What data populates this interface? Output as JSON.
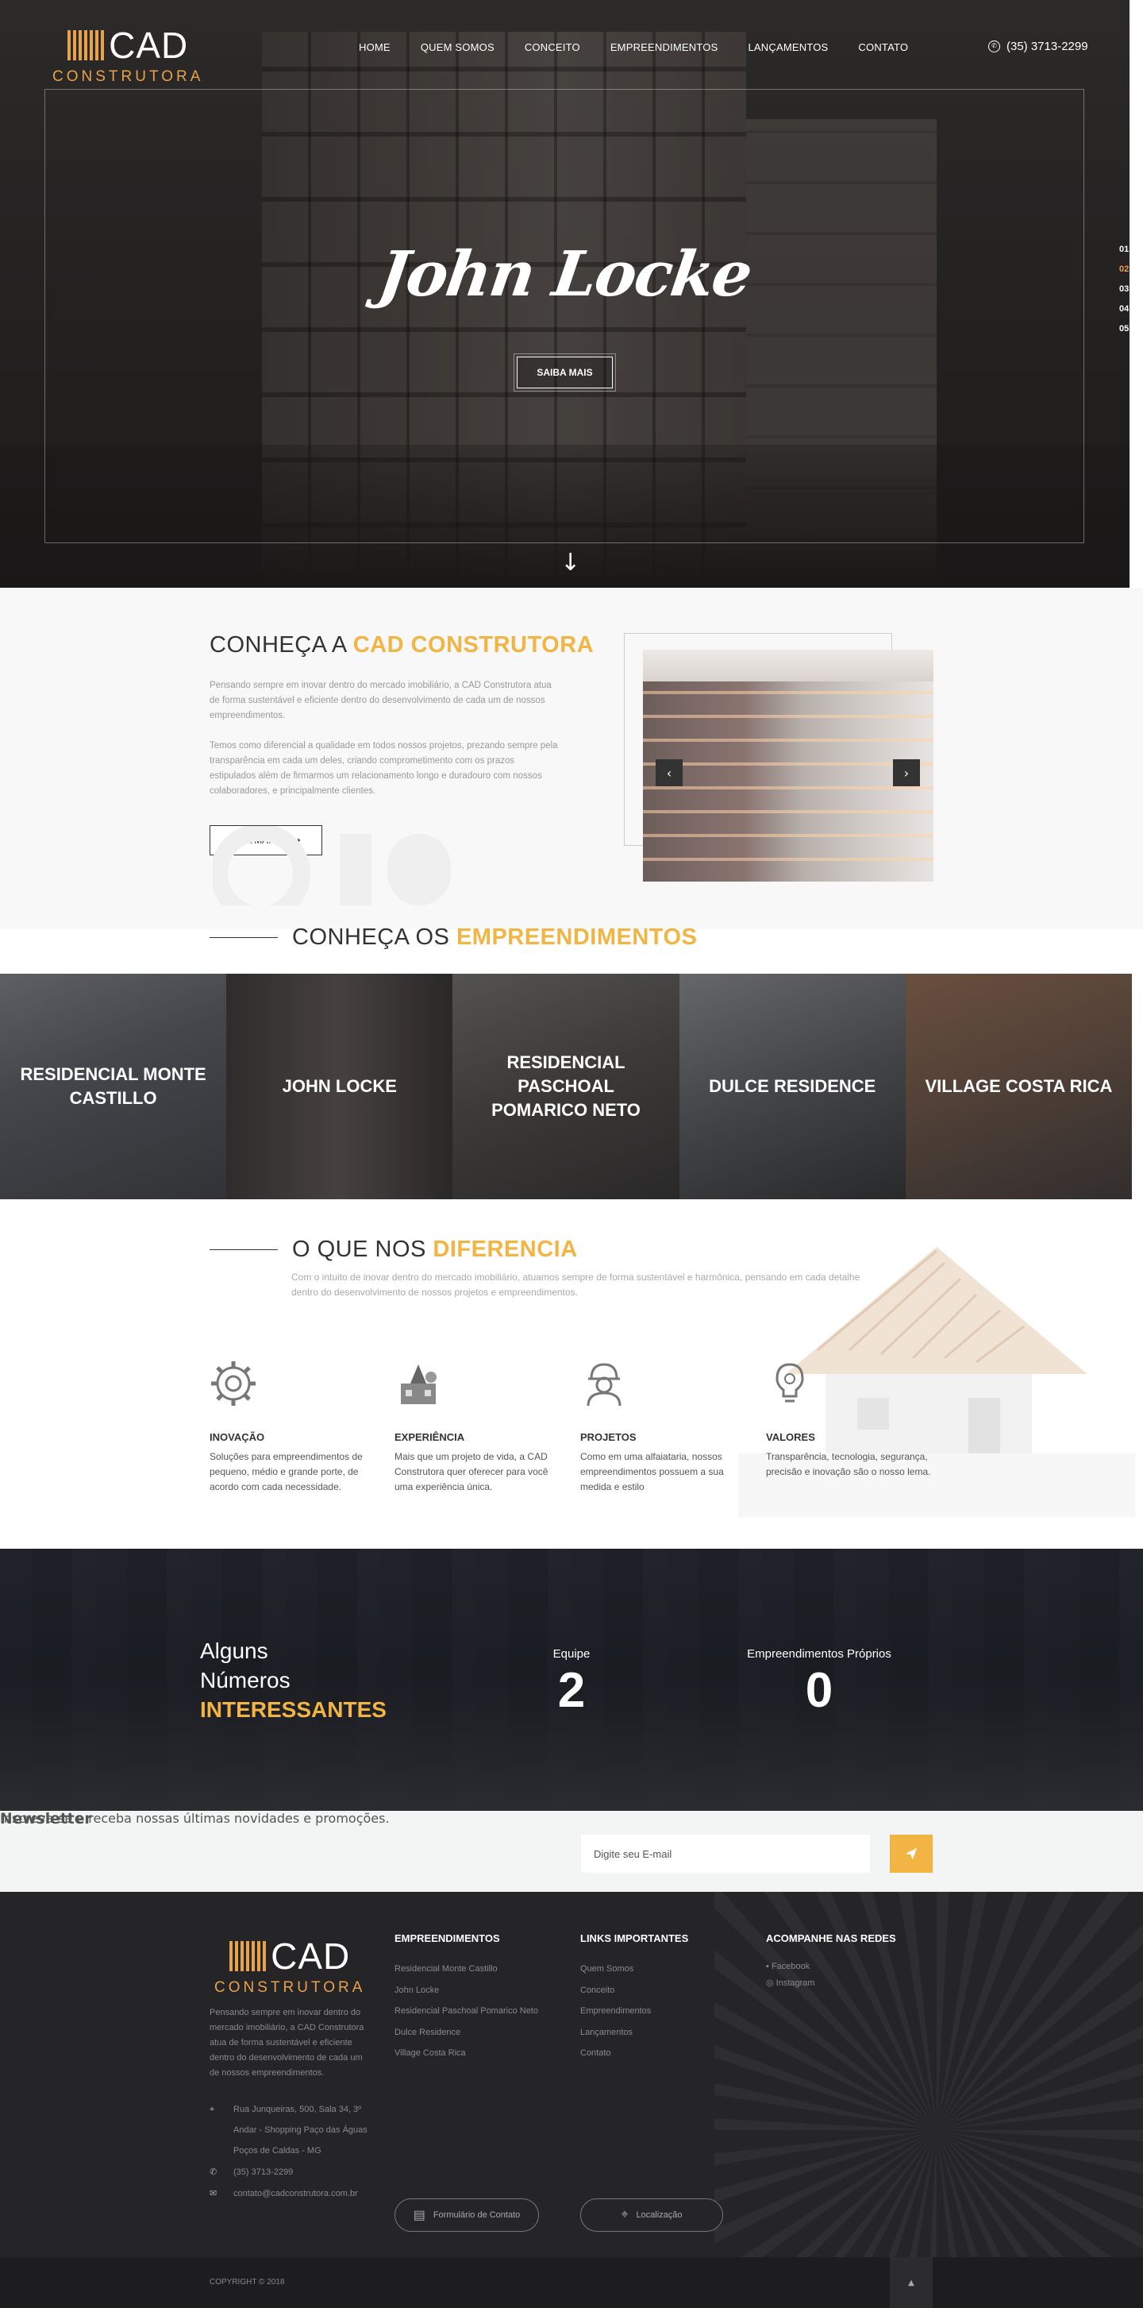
{
  "brand": {
    "name": "CAD",
    "sub": "CONSTRUTORA"
  },
  "nav": {
    "items": [
      "HOME",
      "QUEM SOMOS",
      "CONCEITO",
      "EMPREENDIMENTOS",
      "LANÇAMENTOS",
      "CONTATO"
    ]
  },
  "phone": "(35) 3713-2299",
  "hero": {
    "title": "John Locke",
    "button": "SAIBA MAIS",
    "slides": [
      "01",
      "02",
      "03",
      "04",
      "05"
    ],
    "active_slide": "02"
  },
  "about": {
    "title_pre": "CONHEÇA A",
    "title_accent": "CAD CONSTRUTORA",
    "p1": "Pensando sempre em inovar dentro do mercado imobiliário, a CAD Construtora atua de forma sustentável e eficiente dentro do desenvolvimento de cada um de nossos empreendimentos.",
    "p2": "Temos como diferencial a qualidade em todos nossos projetos, prezando sempre pela transparência em cada um deles, criando comprometimento com os prazos estipulados além de firmarmos um relacionamento longo e duradouro com nossos colaboradores, e principalmente clientes.",
    "button": "LEIA MAIS"
  },
  "empreendimentos": {
    "title_pre": "CONHEÇA OS",
    "title_accent": "EMPREENDIMENTOS",
    "items": [
      "RESIDENCIAL MONTE CASTILLO",
      "JOHN LOCKE",
      "RESIDENCIAL PASCHOAL POMARICO NETO",
      "DULCE RESIDENCE",
      "VILLAGE COSTA RICA"
    ]
  },
  "diferencia": {
    "title_pre": "O QUE NOS",
    "title_accent": "DIFERENCIA",
    "subtitle": "Com o intuito de inovar dentro do mercado imobiliário, atuamos sempre de forma sustentável e harmônica, pensando em cada detalhe dentro do desenvolvimento de nossos projetos e empreendimentos.",
    "features": [
      {
        "title": "INOVAÇÃO",
        "text": "Soluções para empreendimentos de pequeno, médio e grande porte, de acordo com cada necessidade.",
        "icon": "gear-icon"
      },
      {
        "title": "EXPERIÊNCIA",
        "text": "Mais que um projeto de vida, a CAD Construtora quer oferecer para você uma experiência única.",
        "icon": "construction-icon"
      },
      {
        "title": "PROJETOS",
        "text": "Como em uma alfaiataria, nossos empreendimentos possuem a sua medida e estilo",
        "icon": "worker-icon"
      },
      {
        "title": "VALORES",
        "text": "Transparência, tecnologia, segurança, precisão e inovação são o nosso lema.",
        "icon": "idea-icon"
      }
    ]
  },
  "numbers": {
    "title_line1": "Alguns",
    "title_line2": "Números",
    "title_accent": "INTERESSANTES",
    "stats": [
      {
        "label": "Equipe",
        "value": "2"
      },
      {
        "label": "Empreendimentos Próprios",
        "value": "0"
      }
    ]
  },
  "newsletter": {
    "title": "Newsletter",
    "text": "Inscreva-se e receba nossas últimas novidades e promoções.",
    "placeholder": "Digite seu E-mail"
  },
  "footer": {
    "about": "Pensando sempre em inovar dentro do mercado imobiliário, a CAD Construtora atua de forma sustentável e eficiente dentro do desenvolvimento de cada um de nossos empreendimentos.",
    "address_1": "Rua Junqueiras, 500, Sala 34, 3º",
    "address_2": "Andar - Shopping Paço das Águas",
    "address_3": "Poços de Caldas - MG",
    "phone": "(35) 3713-2299",
    "email": "contato@cadconstrutora.com.br",
    "col1_title": "EMPREENDIMENTOS",
    "col1": [
      "Residencial Monte Castillo",
      "John Locke",
      "Residencial Paschoal Pomarico Neto",
      "Dulce Residence",
      "Village Costa Rica"
    ],
    "col2_title": "LINKS IMPORTANTES",
    "col2": [
      "Quem Somos",
      "Conceito",
      "Empreendimentos",
      "Lançamentos",
      "Contato"
    ],
    "col3_title": "ACOMPANHE NAS REDES",
    "col3": [
      "Facebook",
      "Instagram"
    ],
    "form_button": "Formulário de Contato",
    "location_button": "Localização",
    "copyright": "COPYRIGHT © 2018"
  },
  "colors": {
    "accent": "#f2b544",
    "logo_orange": "#e8a24b",
    "dark": "#252427"
  }
}
